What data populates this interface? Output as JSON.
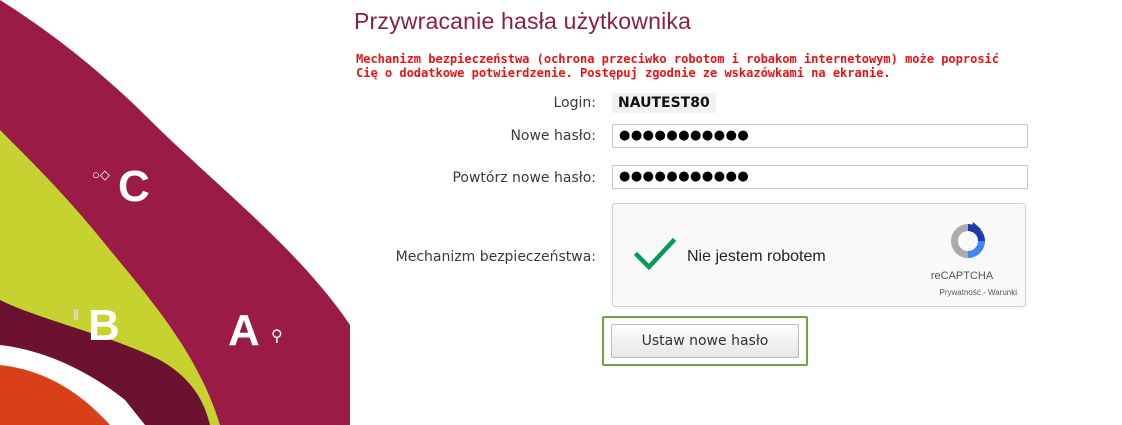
{
  "art": {
    "letters": [
      "C",
      "B",
      "A"
    ],
    "colors": {
      "crimson": "#9b1b48",
      "lime": "#c6d22f",
      "wine": "#6a1230",
      "dark": "#5a1730",
      "orange": "#d9401a"
    }
  },
  "page": {
    "title": "Przywracanie hasła użytkownika",
    "warning_line1": "Mechanizm bezpieczeństwa (ochrona przeciwko robotom i robakom internetowym) może poprosić",
    "warning_line2": "Cię o dodatkowe potwierdzenie. Postępuj zgodnie ze wskazówkami na ekranie."
  },
  "form": {
    "login_label": "Login:",
    "login_value": "NAUTEST80",
    "new_password_label": "Nowe hasło:",
    "new_password_value": "●●●●●●●●●●●",
    "repeat_password_label": "Powtórz nowe hasło:",
    "repeat_password_value": "●●●●●●●●●●●",
    "security_label": "Mechanizm bezpieczeństwa:",
    "submit_label": "Ustaw nowe hasło"
  },
  "captcha": {
    "checkbox_label": "Nie jestem robotem",
    "checked": true,
    "brand": "reCAPTCHA",
    "links": "Prywatność - Warunki"
  },
  "colors": {
    "title": "#8a1e44",
    "warning": "#ee1111",
    "focus_border": "#6aa53d",
    "check": "#009e55"
  }
}
